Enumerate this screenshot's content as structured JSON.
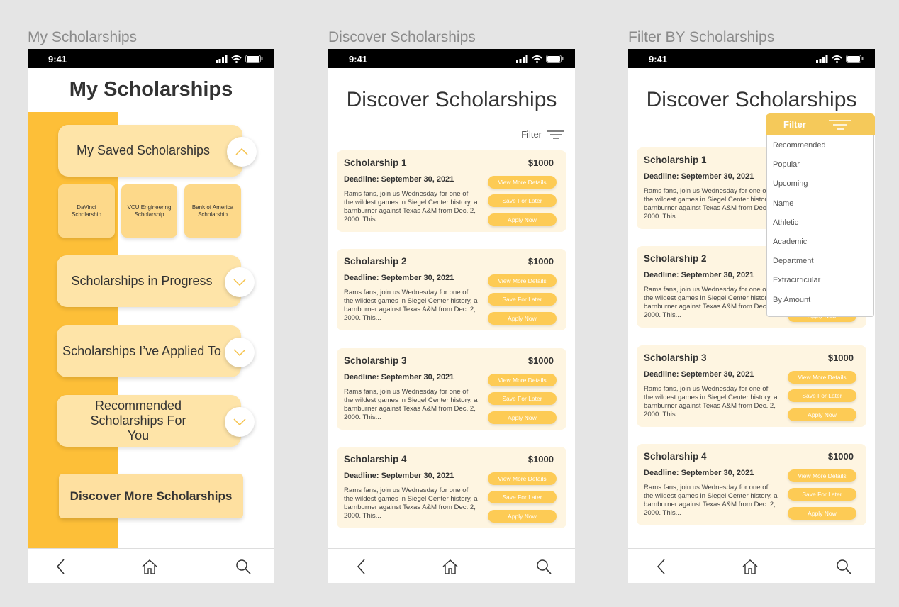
{
  "frames": {
    "my": "My Scholarships",
    "discover": "Discover Scholarships",
    "filter": "Filter BY Scholarships"
  },
  "status": {
    "time": "9:41"
  },
  "my": {
    "title": "My Scholarships",
    "saved": "My Saved Scholarships",
    "saved_items": [
      "DaVinci Scholarship",
      "VCU Engineering Scholarship",
      "Bank of America Scholarship"
    ],
    "in_progress": "Scholarships in Progress",
    "applied": "Scholarships I’ve Applied To",
    "recommended": "Recommended Scholarships For You",
    "discover_more": "Discover More Scholarships"
  },
  "discover": {
    "title": "Discover Scholarships",
    "filter_label": "Filter",
    "buttons": {
      "details": "View More Details",
      "save": "Save For Later",
      "apply": "Apply Now"
    },
    "cards": [
      {
        "title": "Scholarship 1",
        "amount": "$1000",
        "deadline": "Deadline: September 30, 2021",
        "desc": "Rams fans, join us Wednesday for one of the wildest games in Siegel Center history, a barnburner against Texas A&M from Dec. 2, 2000. This..."
      },
      {
        "title": "Scholarship 2",
        "amount": "$1000",
        "deadline": "Deadline: September 30, 2021",
        "desc": "Rams fans, join us Wednesday for one of the wildest games in Siegel Center history, a barnburner against Texas A&M from Dec. 2, 2000. This..."
      },
      {
        "title": "Scholarship 3",
        "amount": "$1000",
        "deadline": "Deadline: September 30, 2021",
        "desc": "Rams fans, join us Wednesday for one of the wildest games in Siegel Center history, a barnburner against Texas A&M from Dec. 2, 2000. This..."
      },
      {
        "title": "Scholarship 4",
        "amount": "$1000",
        "deadline": "Deadline: September 30, 2021",
        "desc": "Rams fans, join us Wednesday for one of the wildest games in Siegel Center history, a barnburner against Texas A&M from Dec. 2, 2000. This..."
      }
    ]
  },
  "filter": {
    "header": "Filter",
    "options": [
      "Recommended",
      "Popular",
      "Upcoming",
      "Name",
      "Athletic",
      "Academic",
      "Department",
      "Extracirricular",
      "By Amount"
    ]
  },
  "colors": {
    "accent": "#FDBF38",
    "pill": "#FEE4A8",
    "button": "#FDCB55",
    "card": "#FEF5E1"
  }
}
